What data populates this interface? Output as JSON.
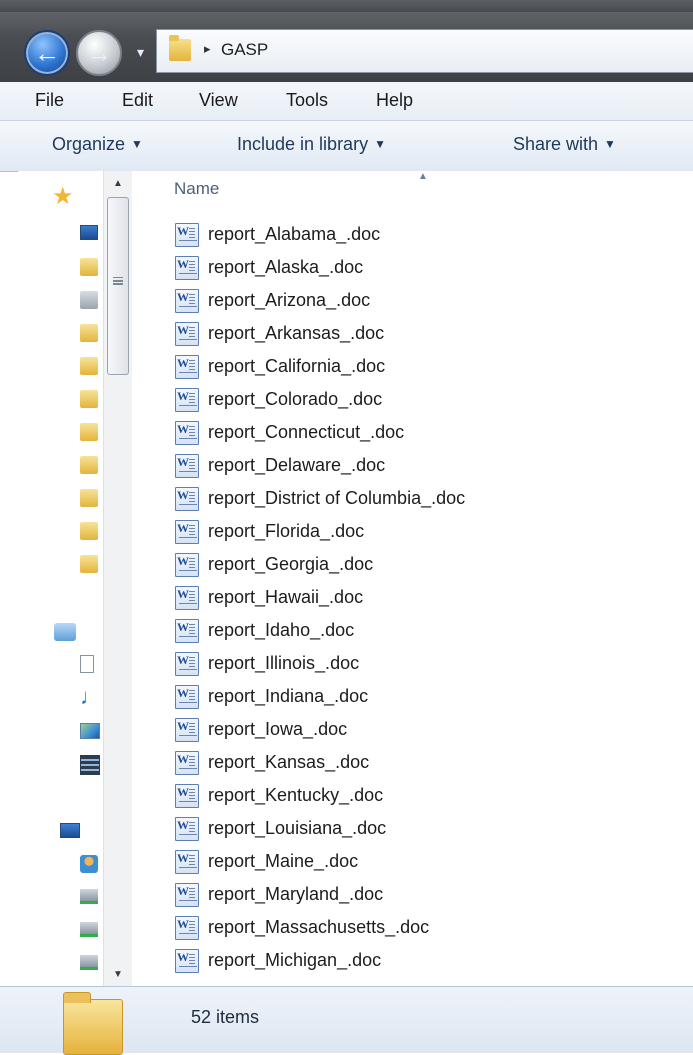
{
  "address_bar": {
    "back_icon": "back-arrow-icon",
    "forward_icon": "forward-arrow-icon",
    "separator": "▸",
    "path": "GASP"
  },
  "menu": [
    "File",
    "Edit",
    "View",
    "Tools",
    "Help"
  ],
  "commands": {
    "organize": "Organize",
    "include_in_library": "Include in library",
    "share_with": "Share with"
  },
  "column_header": {
    "name": "Name",
    "sort": "ascending"
  },
  "files": [
    "report_Alabama_.doc",
    "report_Alaska_.doc",
    "report_Arizona_.doc",
    "report_Arkansas_.doc",
    "report_California_.doc",
    "report_Colorado_.doc",
    "report_Connecticut_.doc",
    "report_Delaware_.doc",
    "report_District of Columbia_.doc",
    "report_Florida_.doc",
    "report_Georgia_.doc",
    "report_Hawaii_.doc",
    "report_Idaho_.doc",
    "report_Illinois_.doc",
    "report_Indiana_.doc",
    "report_Iowa_.doc",
    "report_Kansas_.doc",
    "report_Kentucky_.doc",
    "report_Louisiana_.doc",
    "report_Maine_.doc",
    "report_Maryland_.doc",
    "report_Massachusetts_.doc",
    "report_Michigan_.doc"
  ],
  "status": {
    "item_count": "52 items"
  },
  "colors": {
    "accent_blue": "#2c73cf",
    "command_text": "#1e395b",
    "folder_yellow": "#e3b43b"
  }
}
